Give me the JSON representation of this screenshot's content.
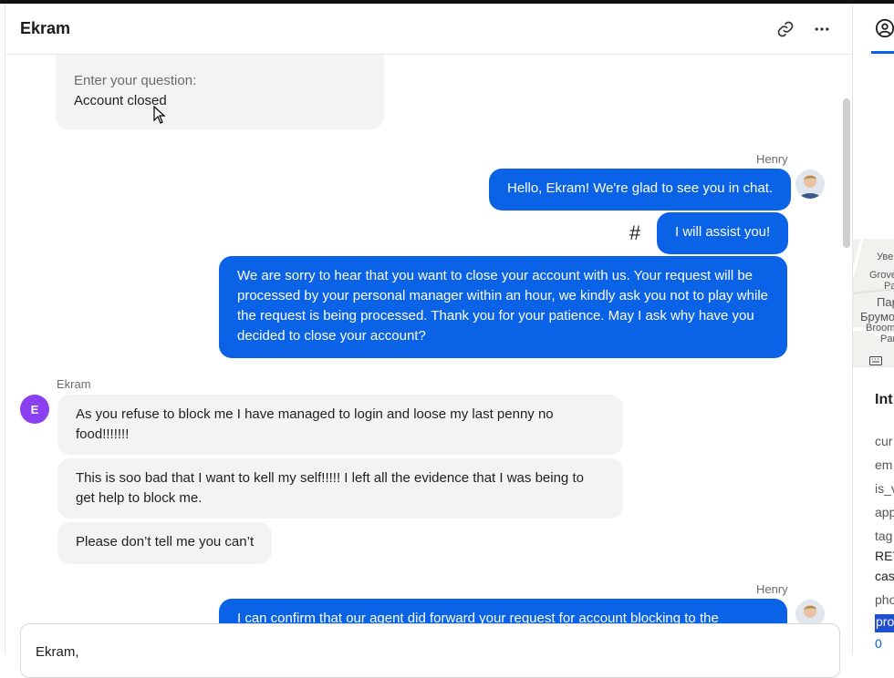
{
  "header": {
    "title": "Ekram",
    "link_icon": "link-icon",
    "more_icon": "more-horizontal-icon"
  },
  "thread": {
    "prompt_card": {
      "label": "Enter your question:",
      "value": "Account closed"
    },
    "agent_group_1": {
      "sender": "Henry",
      "messages": [
        "Hello, Ekram! We're glad to see you in chat.",
        "I will assist you!",
        "We are sorry to hear that you want to close your account with us. Your request will be processed by your personal manager within an hour, we kindly ask you not to play while the request is being processed. Thank you for your patience. May I ask why have you decided to close your account?"
      ],
      "hash_icon_text": "#"
    },
    "customer_group": {
      "sender": "Ekram",
      "avatar_letter": "E",
      "messages": [
        "As you refuse to block me I have managed to login and loose my last penny no food!!!!!!!",
        "This is soo bad that I want to kell my self!!!!! I left all the evidence that I was being to get help to block me.",
        "Please don’t tell me you can’t"
      ]
    },
    "agent_group_2": {
      "sender": "Henry",
      "messages": [
        "I can confirm that our agent did forward your request for account blocking to the"
      ]
    }
  },
  "composer": {
    "text": "Ekram,"
  },
  "sidebar": {
    "map_labels": [
      "Уве",
      "Grove",
      "Pa",
      "Пар",
      "Брумо",
      "Broom",
      "Par"
    ],
    "keyboard_icon": "keyboard-icon",
    "info_title": "Int",
    "fields": [
      "cur",
      "em",
      "is_v",
      "app",
      "tag",
      "RET",
      "cas",
      "pho"
    ],
    "highlighted_field": "pro",
    "highlighted_value": "0"
  },
  "colors": {
    "agent_bubble": "#0a62e6",
    "customer_bubble": "#f3f3f3",
    "avatar_customer": "#8a3ff0"
  }
}
